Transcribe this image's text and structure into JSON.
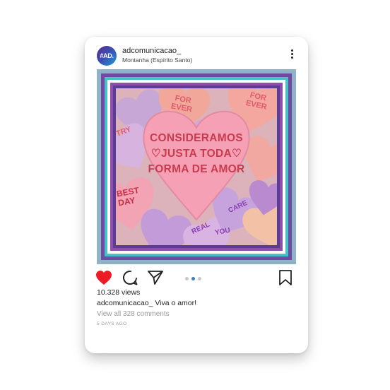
{
  "post": {
    "avatar_text": "#AD.",
    "username": "adcomunicacao_",
    "location": "Montanha (Espírito Santo)",
    "image_text": {
      "line1": "CONSIDERAMOS",
      "line2": "♡JUSTA TODA♡",
      "line3": "FORMA DE AMOR"
    },
    "candy_texts": [
      "FOR EVER",
      "FOR EVER",
      "TRY",
      "BEST DAY",
      "CARE",
      "REAL",
      "YOU"
    ],
    "colors": {
      "like": "#ed1c24",
      "active_dot": "#3a80c4",
      "frame_purple": "#6f4aa3",
      "frame_teal": "#48c2c6",
      "frame_blue_gray": "#8fb2c8",
      "heart_pink": "#f5a0b5",
      "heart_text": "#c93c4f"
    },
    "icons": {
      "like": "heart-filled-icon",
      "comment": "comment-bubble-icon",
      "share": "paper-plane-icon",
      "save": "bookmark-icon",
      "more": "more-vertical-icon"
    },
    "carousel": {
      "count": 3,
      "active": 2
    },
    "views": "10.328 views",
    "caption_user": "adcomunicacao_",
    "caption_text": "Viva o amor!",
    "comments_link": "View all 328 comments",
    "timestamp": "5 DAYS AGO"
  }
}
